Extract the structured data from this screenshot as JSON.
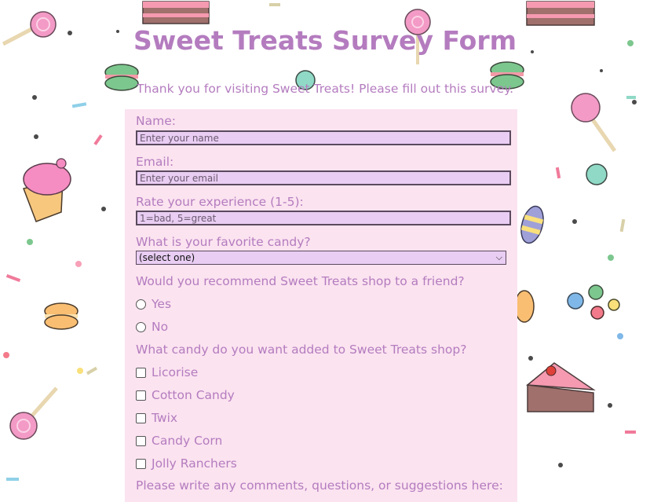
{
  "page": {
    "title": "Sweet Treats Survey Form",
    "intro": "Thank you for visiting Sweet Treats! Please fill out this survey."
  },
  "form": {
    "name_label": "Name:",
    "name_placeholder": "Enter your name",
    "email_label": "Email:",
    "email_placeholder": "Enter your email",
    "rating_label": "Rate your experience (1-5):",
    "rating_placeholder": "1=bad, 5=great",
    "candy_label": "What is your favorite candy?",
    "candy_selected": "(select one)",
    "recommend_label": "Would you recommend Sweet Treats shop to a friend?",
    "recommend_options": [
      "Yes",
      "No"
    ],
    "add_candy_label": "What candy do you want added to Sweet Treats shop?",
    "add_candy_options": [
      "Licorise",
      "Cotton Candy",
      "Twix",
      "Candy Corn",
      "Jolly Ranchers"
    ],
    "comments_label": "Please write any comments, questions, or suggestions here:"
  }
}
